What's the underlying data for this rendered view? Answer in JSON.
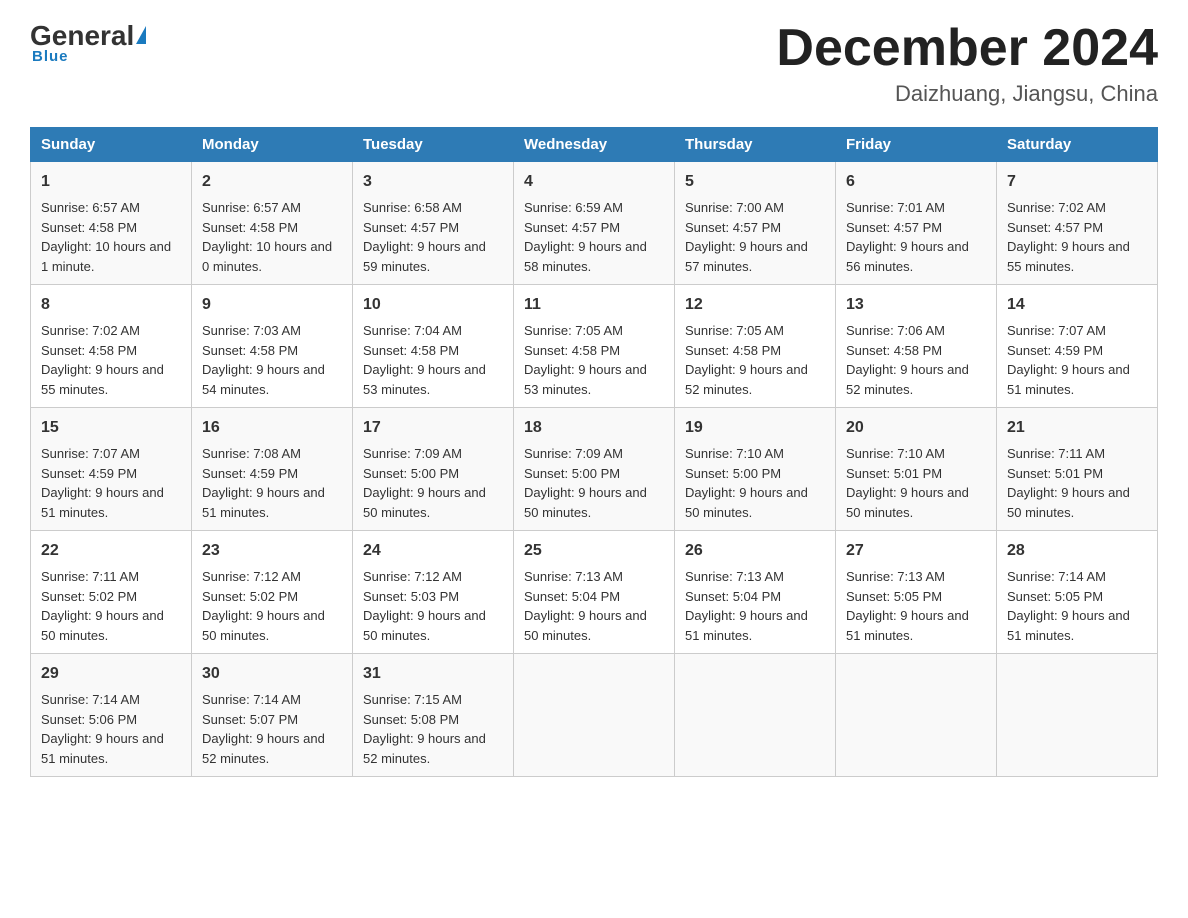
{
  "header": {
    "logo": {
      "general": "General",
      "blue": "Blue",
      "underline": "Blue"
    },
    "title": "December 2024",
    "location": "Daizhuang, Jiangsu, China"
  },
  "days_of_week": [
    "Sunday",
    "Monday",
    "Tuesday",
    "Wednesday",
    "Thursday",
    "Friday",
    "Saturday"
  ],
  "weeks": [
    [
      {
        "day": "1",
        "sunrise": "6:57 AM",
        "sunset": "4:58 PM",
        "daylight": "10 hours and 1 minute."
      },
      {
        "day": "2",
        "sunrise": "6:57 AM",
        "sunset": "4:58 PM",
        "daylight": "10 hours and 0 minutes."
      },
      {
        "day": "3",
        "sunrise": "6:58 AM",
        "sunset": "4:57 PM",
        "daylight": "9 hours and 59 minutes."
      },
      {
        "day": "4",
        "sunrise": "6:59 AM",
        "sunset": "4:57 PM",
        "daylight": "9 hours and 58 minutes."
      },
      {
        "day": "5",
        "sunrise": "7:00 AM",
        "sunset": "4:57 PM",
        "daylight": "9 hours and 57 minutes."
      },
      {
        "day": "6",
        "sunrise": "7:01 AM",
        "sunset": "4:57 PM",
        "daylight": "9 hours and 56 minutes."
      },
      {
        "day": "7",
        "sunrise": "7:02 AM",
        "sunset": "4:57 PM",
        "daylight": "9 hours and 55 minutes."
      }
    ],
    [
      {
        "day": "8",
        "sunrise": "7:02 AM",
        "sunset": "4:58 PM",
        "daylight": "9 hours and 55 minutes."
      },
      {
        "day": "9",
        "sunrise": "7:03 AM",
        "sunset": "4:58 PM",
        "daylight": "9 hours and 54 minutes."
      },
      {
        "day": "10",
        "sunrise": "7:04 AM",
        "sunset": "4:58 PM",
        "daylight": "9 hours and 53 minutes."
      },
      {
        "day": "11",
        "sunrise": "7:05 AM",
        "sunset": "4:58 PM",
        "daylight": "9 hours and 53 minutes."
      },
      {
        "day": "12",
        "sunrise": "7:05 AM",
        "sunset": "4:58 PM",
        "daylight": "9 hours and 52 minutes."
      },
      {
        "day": "13",
        "sunrise": "7:06 AM",
        "sunset": "4:58 PM",
        "daylight": "9 hours and 52 minutes."
      },
      {
        "day": "14",
        "sunrise": "7:07 AM",
        "sunset": "4:59 PM",
        "daylight": "9 hours and 51 minutes."
      }
    ],
    [
      {
        "day": "15",
        "sunrise": "7:07 AM",
        "sunset": "4:59 PM",
        "daylight": "9 hours and 51 minutes."
      },
      {
        "day": "16",
        "sunrise": "7:08 AM",
        "sunset": "4:59 PM",
        "daylight": "9 hours and 51 minutes."
      },
      {
        "day": "17",
        "sunrise": "7:09 AM",
        "sunset": "5:00 PM",
        "daylight": "9 hours and 50 minutes."
      },
      {
        "day": "18",
        "sunrise": "7:09 AM",
        "sunset": "5:00 PM",
        "daylight": "9 hours and 50 minutes."
      },
      {
        "day": "19",
        "sunrise": "7:10 AM",
        "sunset": "5:00 PM",
        "daylight": "9 hours and 50 minutes."
      },
      {
        "day": "20",
        "sunrise": "7:10 AM",
        "sunset": "5:01 PM",
        "daylight": "9 hours and 50 minutes."
      },
      {
        "day": "21",
        "sunrise": "7:11 AM",
        "sunset": "5:01 PM",
        "daylight": "9 hours and 50 minutes."
      }
    ],
    [
      {
        "day": "22",
        "sunrise": "7:11 AM",
        "sunset": "5:02 PM",
        "daylight": "9 hours and 50 minutes."
      },
      {
        "day": "23",
        "sunrise": "7:12 AM",
        "sunset": "5:02 PM",
        "daylight": "9 hours and 50 minutes."
      },
      {
        "day": "24",
        "sunrise": "7:12 AM",
        "sunset": "5:03 PM",
        "daylight": "9 hours and 50 minutes."
      },
      {
        "day": "25",
        "sunrise": "7:13 AM",
        "sunset": "5:04 PM",
        "daylight": "9 hours and 50 minutes."
      },
      {
        "day": "26",
        "sunrise": "7:13 AM",
        "sunset": "5:04 PM",
        "daylight": "9 hours and 51 minutes."
      },
      {
        "day": "27",
        "sunrise": "7:13 AM",
        "sunset": "5:05 PM",
        "daylight": "9 hours and 51 minutes."
      },
      {
        "day": "28",
        "sunrise": "7:14 AM",
        "sunset": "5:05 PM",
        "daylight": "9 hours and 51 minutes."
      }
    ],
    [
      {
        "day": "29",
        "sunrise": "7:14 AM",
        "sunset": "5:06 PM",
        "daylight": "9 hours and 51 minutes."
      },
      {
        "day": "30",
        "sunrise": "7:14 AM",
        "sunset": "5:07 PM",
        "daylight": "9 hours and 52 minutes."
      },
      {
        "day": "31",
        "sunrise": "7:15 AM",
        "sunset": "5:08 PM",
        "daylight": "9 hours and 52 minutes."
      },
      null,
      null,
      null,
      null
    ]
  ]
}
